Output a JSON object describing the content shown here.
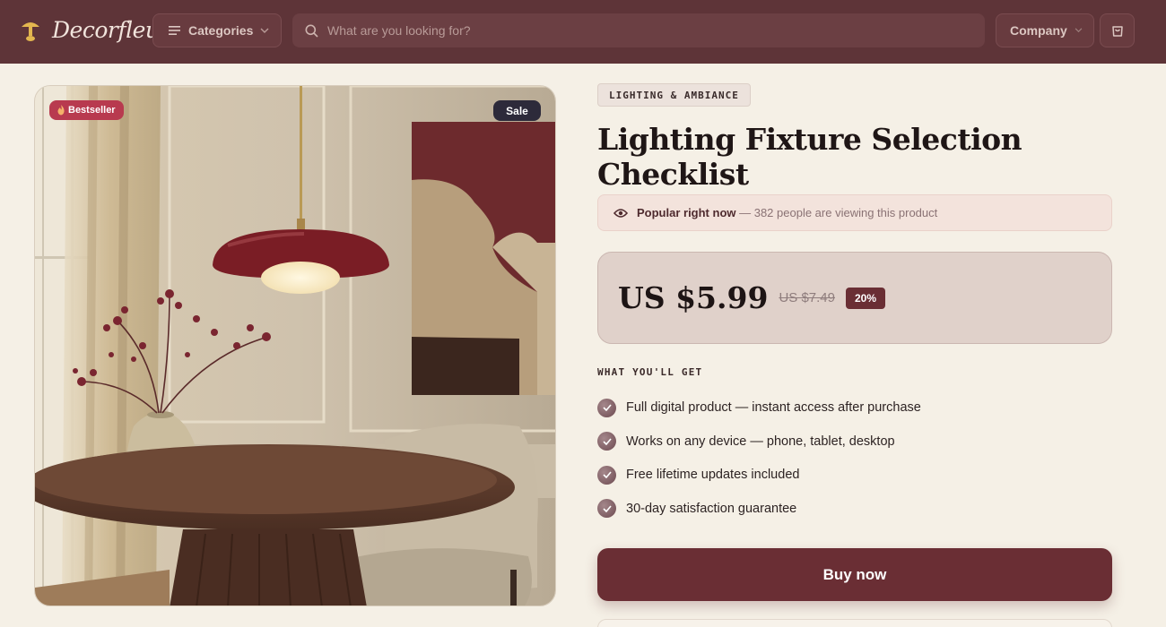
{
  "header": {
    "brand": "Decorfleur",
    "categories_label": "Categories",
    "search_placeholder": "What are you looking for?",
    "company_label": "Company"
  },
  "product": {
    "badges": {
      "bestseller": "Bestseller",
      "sale": "Sale"
    },
    "category": "LIGHTING & AMBIANCE",
    "title": "Lighting Fixture Selection Checklist",
    "popular": {
      "label": "Popular right now",
      "detail": " — 382 people are viewing this product"
    },
    "price": {
      "current": "US $5.99",
      "original": "US $7.49",
      "discount": "20%"
    },
    "features_heading": "WHAT YOU'LL GET",
    "features": [
      "Full digital product — instant access after purchase",
      "Works on any device — phone, tablet, desktop",
      "Free lifetime updates included",
      "30-day satisfaction guarantee"
    ],
    "buy_label": "Buy now"
  },
  "colors": {
    "header_bg": "#5e3438",
    "page_bg": "#f5f0e6",
    "accent": "#6a2e34",
    "bestseller_badge": "#b83a4f",
    "sale_badge": "#2d2a3a"
  },
  "icons": [
    "brand-lamp-icon",
    "menu-icon",
    "chevron-down-icon",
    "search-icon",
    "cart-icon",
    "flame-icon",
    "eye-icon",
    "check-icon"
  ]
}
